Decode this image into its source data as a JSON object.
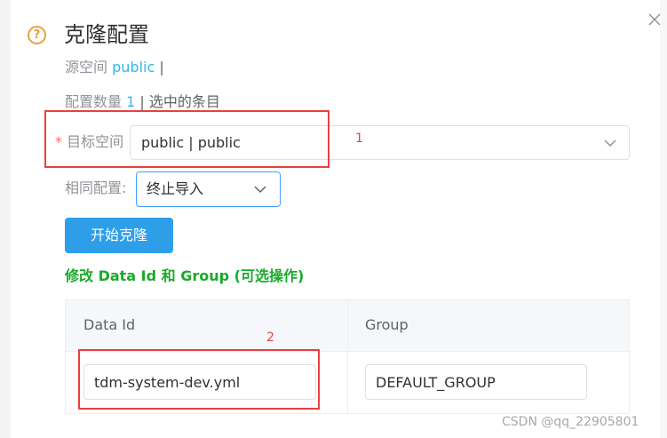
{
  "dialog": {
    "title": "克隆配置",
    "help_icon_char": "?",
    "source": {
      "label": "源空间",
      "value": "public",
      "separator": "|"
    },
    "count": {
      "label": "配置数量",
      "value": "1",
      "suffix": "| 选中的条目"
    }
  },
  "form": {
    "target": {
      "required_mark": "*",
      "label": "目标空间",
      "value": "public | public"
    },
    "policy": {
      "label": "相同配置:",
      "value": "终止导入"
    },
    "start_button": "开始克隆"
  },
  "section_title": "修改 Data Id 和 Group (可选操作)",
  "table": {
    "columns": [
      "Data Id",
      "Group"
    ],
    "rows": [
      {
        "data_id": "tdm-system-dev.yml",
        "group": "DEFAULT_GROUP"
      }
    ]
  },
  "annotations": [
    {
      "label": "1"
    },
    {
      "label": "2"
    }
  ],
  "watermark": "CSDN @qq_22905801",
  "colors": {
    "accent": "#2f9ee8",
    "highlight": "#2fb8e8",
    "section_green": "#1aaa2b",
    "annotation_red": "#e8403e",
    "warning": "#e6a23c",
    "required": "#f56c6c"
  },
  "icons": {
    "help": "question-circle-icon",
    "close": "close-icon",
    "dropdown": "chevron-down-icon"
  }
}
